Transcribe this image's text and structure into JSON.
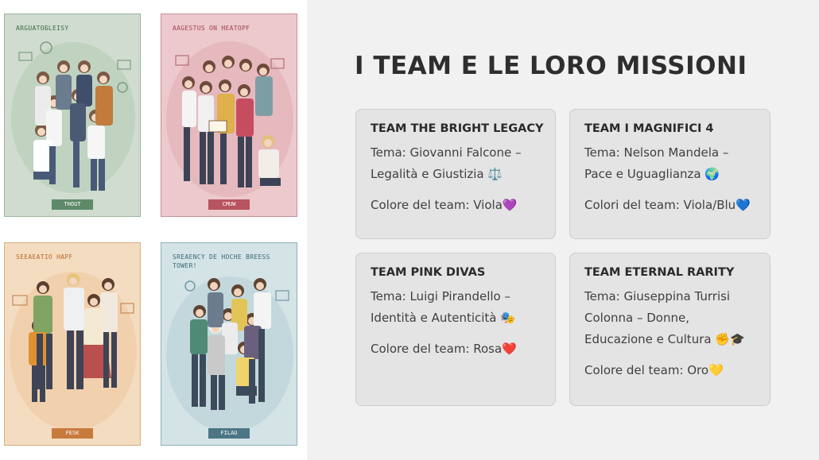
{
  "posters": [
    {
      "caption": "ARGUATOБLEISY",
      "tag": "THOUT"
    },
    {
      "caption": "AAGESTUS ON HEATOPF",
      "tag": "CMUW"
    },
    {
      "caption": "SEEAEATIO HAPF",
      "tag": "FESK"
    },
    {
      "caption": "SREAENCY DE HOCHE BREESS TOWER!",
      "tag": "FILAU"
    }
  ],
  "slide": {
    "title": "I TEAM E LE LORO MISSIONI"
  },
  "teams": [
    {
      "name": "TEAM THE BRIGHT LEGACY",
      "theme": "Tema: Giovanni Falcone – Legalità e Giustizia ⚖️",
      "color": "Colore del team: Viola💜"
    },
    {
      "name": "TEAM I MAGNIFICI 4",
      "theme": "Tema: Nelson Mandela – Pace e Uguaglianza 🌍",
      "color": "Colori del team: Viola/Blu💙"
    },
    {
      "name": "TEAM PINK DIVAS",
      "theme": "Tema: Luigi Pirandello – Identità e Autenticità 🎭",
      "color": "Colore del team: Rosa❤️"
    },
    {
      "name": "TEAM ETERNAL RARITY",
      "theme": "Tema: Giuseppina Turrisi Colonna – Donne, Educazione e Cultura ✊🎓",
      "color": "Colore del team: Oro💛"
    }
  ]
}
